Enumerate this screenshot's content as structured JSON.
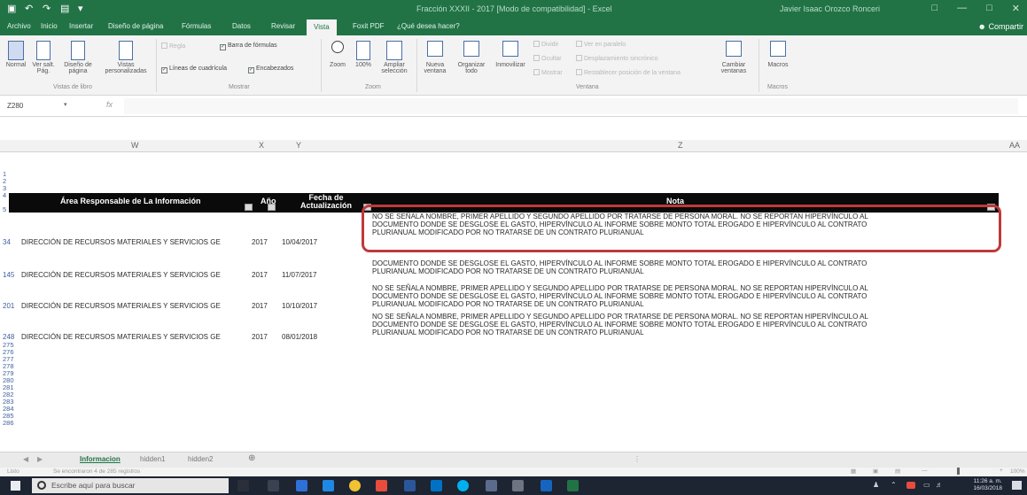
{
  "window": {
    "title": "Fracción XXXII - 2017 [Modo de compatibilidad] - Excel",
    "user": "Javier Isaac Orozco Ronceri"
  },
  "ribbon_tabs": [
    "Archivo",
    "Inicio",
    "Insertar",
    "Diseño de página",
    "Fórmulas",
    "Datos",
    "Revisar",
    "Vista",
    "Foxit PDF",
    "¿Qué desea hacer?"
  ],
  "active_tab": "Vista",
  "share_label": "Compartir",
  "ribbon": {
    "normal": "Normal",
    "ver_salt": "Ver salt. Pág.",
    "diseno_pagina": "Diseño de página",
    "vistas_pers": "Vistas personalizadas",
    "vistas_libro_group": "Vistas de libro",
    "regla": "Regla",
    "barra_formulas": "Barra de fórmulas",
    "lineas_cuadricula": "Líneas de cuadrícula",
    "encabezados": "Encabezados",
    "mostrar_group": "Mostrar",
    "zoom": "Zoom",
    "zoom100": "100%",
    "ampliar_seleccion": "Ampliar selección",
    "zoom_group": "Zoom",
    "nueva_ventana": "Nueva ventana",
    "organizar_todo": "Organizar todo",
    "inmovilizar": "Inmovilizar",
    "dividir": "Dividir",
    "ocultar": "Ocultar",
    "mostrar": "Mostrar",
    "ver_paralelo": "Ver en paralelo",
    "desp_sincronico": "Desplazamiento sincrónico",
    "restablecer_pos": "Restablecer posición de la ventana",
    "ventana_group": "Ventana",
    "cambiar_ventanas": "Cambiar ventanas",
    "macros": "Macros",
    "macros_group": "Macros"
  },
  "formula_bar": {
    "name_box": "Z280",
    "fx": "fx",
    "value": ""
  },
  "columns": [
    "W",
    "X",
    "Y",
    "Z",
    "AA"
  ],
  "table_header": {
    "area": "Área Responsable de La Información",
    "anio": "Año",
    "fecha": "Fecha de Actualización",
    "nota": "Nota"
  },
  "header_row_numbers": [
    "1",
    "2",
    "3",
    "4",
    "5"
  ],
  "rows": [
    {
      "row": "34",
      "area": "DIRECCIÓN DE RECURSOS MATERIALES Y SERVICIOS GE",
      "anio": "2017",
      "fecha": "10/04/2017",
      "nota_l1": "NO SE SEÑALA NOMBRE, PRIMER APELLIDO Y SEGUNDO APELLIDO POR TRATARSE DE PERSONA MORAL. NO SE REPORTAN HIPERVÍNCULO AL",
      "nota_l2": "DOCUMENTO DONDE SE DESGLOSE EL GASTO, HIPERVÍNCULO AL INFORME SOBRE MONTO TOTAL EROGADO E HIPERVÍNCULO AL CONTRATO",
      "nota_l3": "PLURIANUAL MODIFICADO POR NO TRATARSE DE UN CONTRATO PLURIANUAL"
    },
    {
      "row": "145",
      "area": "DIRECCIÓN DE RECURSOS MATERIALES Y SERVICIOS GE",
      "anio": "2017",
      "fecha": "11/07/2017",
      "nota_l1": "DOCUMENTO DONDE SE DESGLOSE EL GASTO, HIPERVÍNCULO AL INFORME SOBRE MONTO TOTAL EROGADO E HIPERVÍNCULO AL CONTRATO",
      "nota_l2": "PLURIANUAL MODIFICADO POR NO TRATARSE DE UN CONTRATO PLURIANUAL",
      "nota_l3": ""
    },
    {
      "row": "201",
      "area": "DIRECCIÓN DE RECURSOS MATERIALES Y SERVICIOS GE",
      "anio": "2017",
      "fecha": "10/10/2017",
      "nota_l1": "NO SE SEÑALA NOMBRE, PRIMER APELLIDO Y SEGUNDO APELLIDO POR TRATARSE DE PERSONA MORAL. NO SE REPORTAN HIPERVÍNCULO AL",
      "nota_l2": "DOCUMENTO DONDE SE DESGLOSE EL GASTO, HIPERVÍNCULO AL INFORME SOBRE MONTO TOTAL EROGADO E HIPERVÍNCULO AL CONTRATO",
      "nota_l3": "PLURIANUAL MODIFICADO POR NO TRATARSE DE UN CONTRATO PLURIANUAL"
    },
    {
      "row": "248",
      "area": "DIRECCIÓN DE RECURSOS MATERIALES Y SERVICIOS GE",
      "anio": "2017",
      "fecha": "08/01/2018",
      "nota_l1": "NO SE SEÑALA NOMBRE, PRIMER APELLIDO Y SEGUNDO APELLIDO POR TRATARSE DE PERSONA MORAL. NO SE REPORTAN HIPERVÍNCULO AL",
      "nota_l2": "DOCUMENTO DONDE SE DESGLOSE EL GASTO, HIPERVÍNCULO AL INFORME SOBRE MONTO TOTAL EROGADO E HIPERVÍNCULO AL CONTRATO",
      "nota_l3": "PLURIANUAL MODIFICADO POR NO TRATARSE DE UN CONTRATO PLURIANUAL"
    }
  ],
  "trailing_rows": [
    "275",
    "276",
    "277",
    "278",
    "279",
    "280",
    "281",
    "282",
    "283",
    "284",
    "285",
    "286"
  ],
  "sheet_tabs": [
    "Informacion",
    "hidden1",
    "hidden2"
  ],
  "status_bar": {
    "mode": "Listo",
    "filter_msg": "Se encontraron 4 de 285 registros",
    "zoom": "100%"
  },
  "taskbar": {
    "search_placeholder": "Escribe aquí para buscar",
    "time": "11:26 a. m.",
    "date": "16/03/2018"
  },
  "colors": {
    "excel_green": "#217346",
    "highlight_red": "#c0393b",
    "header_black": "#0a0a0a"
  }
}
